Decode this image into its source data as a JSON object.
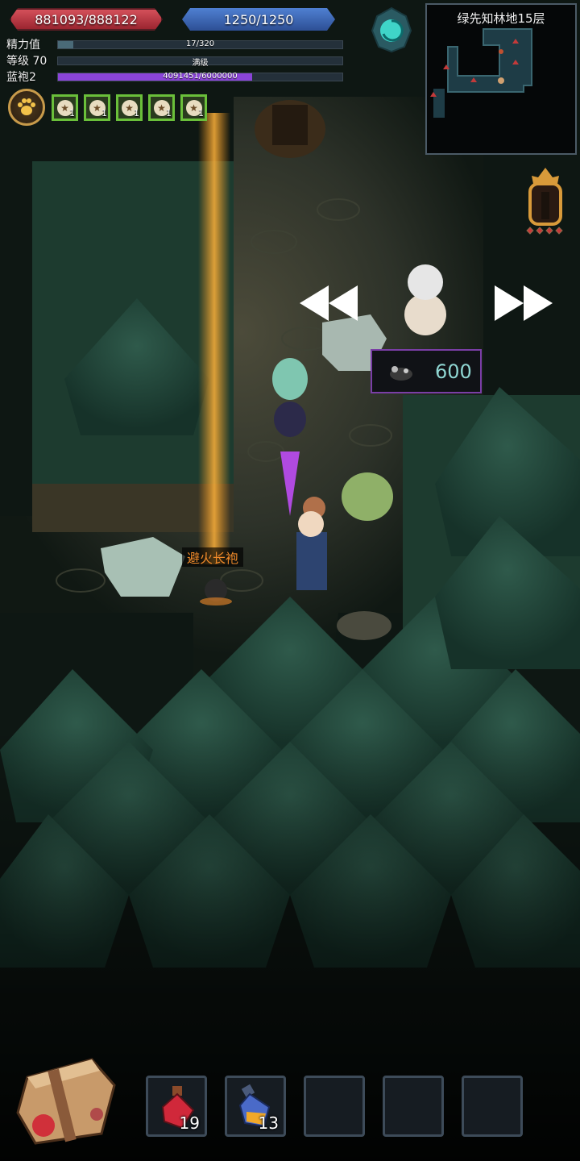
{
  "hud": {
    "hp": "881093/888122",
    "mp": "1250/1250",
    "stats": [
      {
        "label": "精力值",
        "text": "17/320",
        "fill": 0.053,
        "color": "#4a6a78"
      },
      {
        "label": "等级 70",
        "text": "满级",
        "fill": 0,
        "color": "#4a6a78"
      },
      {
        "label": "蓝袍2",
        "text": "4091451/6000000",
        "fill": 0.682,
        "color": "#8a44d8"
      }
    ]
  },
  "buffs": [
    {
      "count": "1"
    },
    {
      "count": "1"
    },
    {
      "count": "1"
    },
    {
      "count": "1"
    },
    {
      "count": "1"
    }
  ],
  "minimap": {
    "title": "绿先知林地15层"
  },
  "score": {
    "value": "600"
  },
  "item_label": "避火长袍",
  "inventory": [
    {
      "icon": "red-potion-icon",
      "count": "19"
    },
    {
      "icon": "blue-potion-icon",
      "count": "13"
    },
    {
      "icon": "",
      "count": ""
    },
    {
      "icon": "",
      "count": ""
    },
    {
      "icon": "",
      "count": ""
    }
  ],
  "colors": {
    "hp": "#c23a45",
    "mp": "#3a64b8",
    "exp": "#8a44d8",
    "buff_border": "#6abf3a",
    "score_border": "#7a3ea6",
    "item_label": "#f08a2a"
  }
}
